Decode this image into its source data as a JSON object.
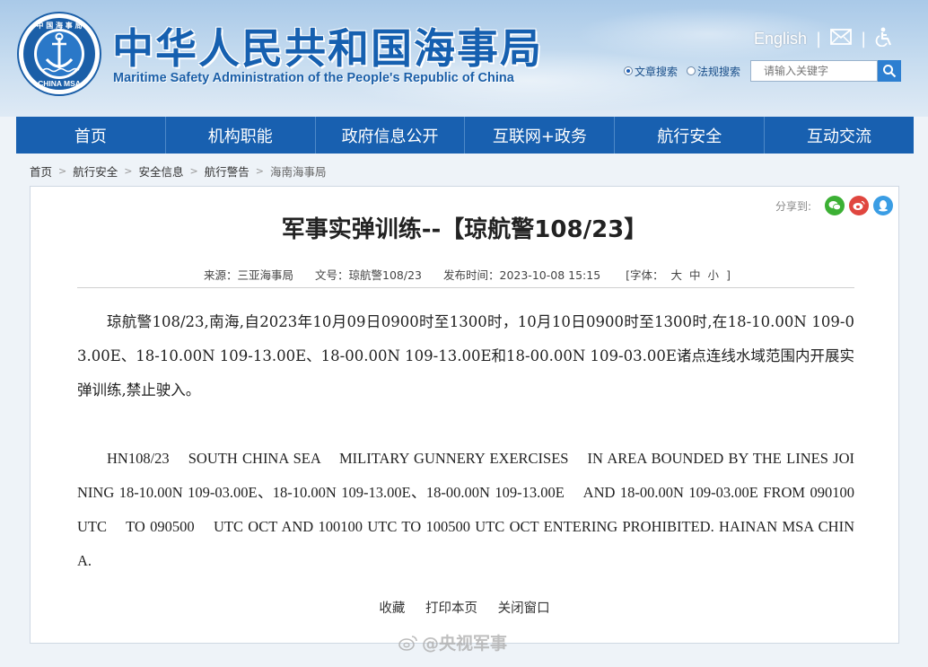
{
  "header": {
    "title": "中华人民共和国海事局",
    "subtitle": "Maritime Safety Administration of the People's Republic of China",
    "logo_text_cn": "中国海事局",
    "logo_text_en": "CHINA MSA",
    "english_link": "English",
    "search": {
      "option1": "文章搜索",
      "option2": "法规搜索",
      "placeholder": "请输入关键字"
    }
  },
  "nav": {
    "items": [
      "首页",
      "机构职能",
      "政府信息公开",
      "互联网+政务",
      "航行安全",
      "互动交流"
    ]
  },
  "breadcrumb": {
    "items": [
      "首页",
      "航行安全",
      "安全信息",
      "航行警告",
      "海南海事局"
    ]
  },
  "share": {
    "label": "分享到:"
  },
  "article": {
    "title": "军事实弹训练--【琼航警108/23】",
    "source": "来源：三亚海事局",
    "doc_no": "文号：琼航警108/23",
    "publish_time": "发布时间：2023-10-08 15:15",
    "font_label": "[字体：",
    "font_large": "大",
    "font_medium": "中",
    "font_small": "小",
    "font_end": "]",
    "para_cn": "琼航警108/23,南海,自2023年10月09日0900时至1300时，10月10日0900时至1300时,在18-10.00N 109-03.00E、18-10.00N 109-13.00E、18-00.00N 109-13.00E和18-00.00N 109-03.00E诸点连线水域范围内开展实弹训练,禁止驶入。",
    "para_en": "HN108/23    SOUTH CHINA SEA    MILITARY GUNNERY EXERCISES    IN AREA BOUNDED BY THE LINES JOINING 18-10.00N 109-03.00E、18-10.00N 109-13.00E、18-00.00N 109-13.00E    AND 18-00.00N 109-03.00E FROM 090100    UTC    TO 090500    UTC OCT AND 100100 UTC TO 100500 UTC OCT ENTERING PROHIBITED. HAINAN MSA CHINA."
  },
  "actions": {
    "favorite": "收藏",
    "print": "打印本页",
    "close": "关闭窗口"
  },
  "watermark": "@央视军事",
  "colors": {
    "nav_bg": "#1860b0",
    "title_blue": "#1660b0",
    "wechat": "#3cb034",
    "weibo": "#e0463f",
    "qq": "#3a9de4"
  }
}
